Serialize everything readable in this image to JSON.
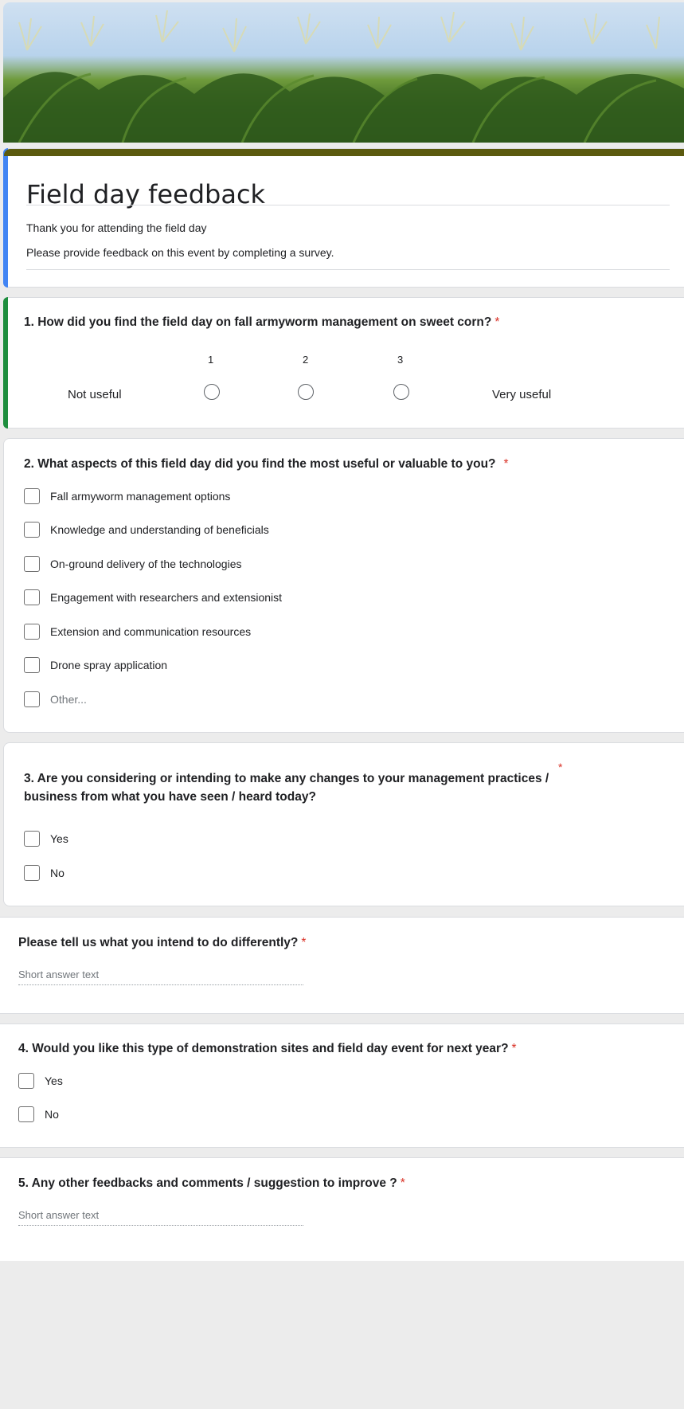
{
  "form": {
    "title": "Field day feedback",
    "description_lines": [
      "Thank you for attending the field day",
      "Please provide feedback on this event by completing a survey."
    ]
  },
  "colors": {
    "theme": "#5b5a0e",
    "accent_blue": "#4285f4",
    "accent_green": "#1e8e3e",
    "required": "#d93025"
  },
  "questions": {
    "q1": {
      "title": "1. How did you find the field day on fall armyworm management on sweet corn?",
      "required_mark": "*",
      "scale": [
        "1",
        "2",
        "3"
      ],
      "min_label": "Not useful",
      "max_label": "Very useful"
    },
    "q2": {
      "title": "2. What aspects of this field day did you find the most useful or valuable to you?",
      "required_mark": "*",
      "options": [
        "Fall armyworm management options",
        "Knowledge and understanding of beneficials",
        "On-ground delivery of the technologies",
        "Engagement with researchers and extensionist",
        "Extension and communication resources",
        "Drone spray application",
        "Other..."
      ]
    },
    "q3": {
      "title_line1": "3. Are you considering or intending to make any changes to your management practices /",
      "title_line2": "business from what you have seen / heard today?",
      "required_mark": "*",
      "options": [
        "Yes",
        "No"
      ]
    },
    "q3b": {
      "title": "Please tell us what you intend to do differently?",
      "required_mark": "*",
      "placeholder": "Short answer text"
    },
    "q4": {
      "title": "4. Would you like this type of demonstration sites and field day event for next year?",
      "required_mark": "*",
      "options": [
        "Yes",
        "No"
      ]
    },
    "q5": {
      "title": "5. Any other feedbacks and comments / suggestion to improve ?",
      "required_mark": "*",
      "placeholder": "Short answer text"
    }
  }
}
